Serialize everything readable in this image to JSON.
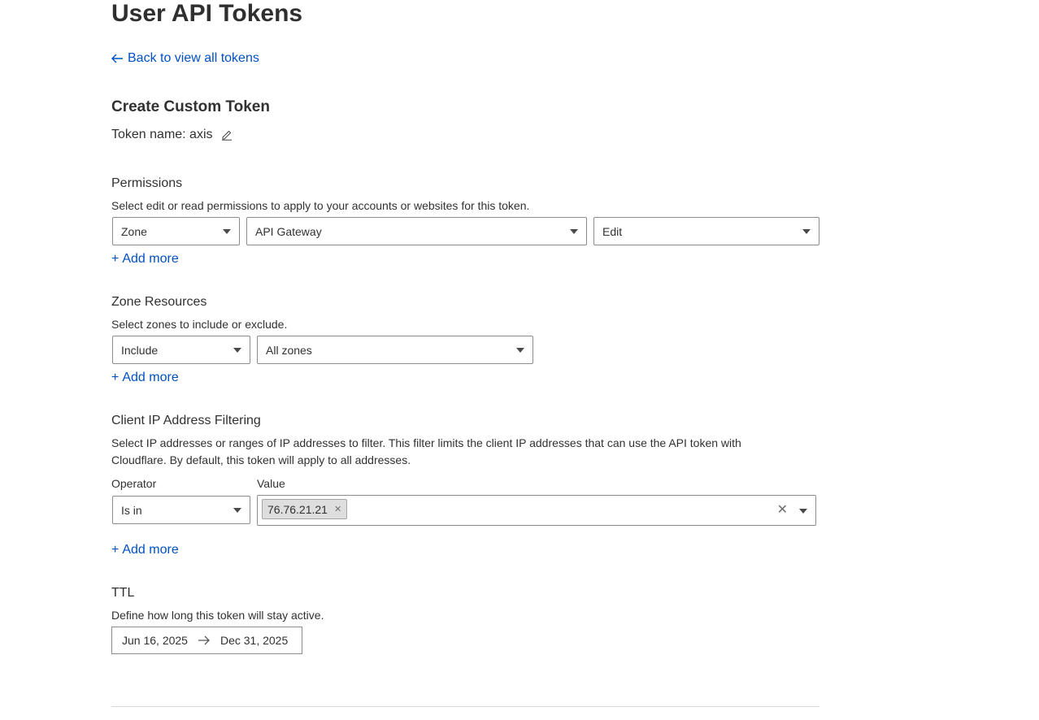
{
  "page": {
    "title": "User API Tokens",
    "back_link": "Back to view all tokens"
  },
  "token": {
    "section_title": "Create Custom Token",
    "name_label": "Token name: axis"
  },
  "permissions": {
    "heading": "Permissions",
    "description": "Select edit or read permissions to apply to your accounts or websites for this token.",
    "scope": "Zone",
    "resource": "API Gateway",
    "level": "Edit",
    "add_more": "Add more"
  },
  "zone_resources": {
    "heading": "Zone Resources",
    "description": "Select zones to include or exclude.",
    "mode": "Include",
    "zones": "All zones",
    "add_more": "Add more"
  },
  "ip_filtering": {
    "heading": "Client IP Address Filtering",
    "description_line1": "Select IP addresses or ranges of IP addresses to filter. This filter limits the client IP addresses that can use the API token with",
    "description_line2": "Cloudflare. By default, this token will apply to all addresses.",
    "operator_label": "Operator",
    "value_label": "Value",
    "operator": "Is in",
    "values": [
      "76.76.21.21"
    ],
    "add_more": "Add more"
  },
  "ttl": {
    "heading": "TTL",
    "description": "Define how long this token will stay active.",
    "start_date": "Jun 16, 2025",
    "end_date": "Dec 31, 2025"
  },
  "icons": {
    "back": "arrow-left-icon",
    "edit": "pencil-icon",
    "add": "plus-icon",
    "range": "arrow-right-icon",
    "dropdown": "caret-down-icon",
    "remove": "close-icon"
  },
  "colors": {
    "link": "#0051c3",
    "text": "#313131",
    "border": "#8c8c8c"
  }
}
